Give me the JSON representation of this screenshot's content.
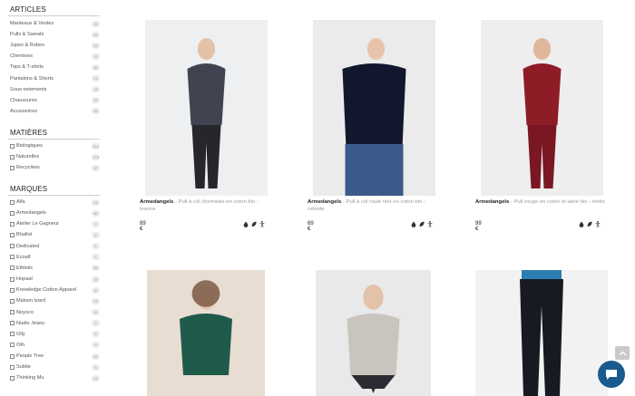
{
  "sidebar": {
    "articles": {
      "title": "ARTICLES",
      "items": [
        {
          "label": "Manteaux & Vestes",
          "count": "23"
        },
        {
          "label": "Pulls & Sweats",
          "count": "42"
        },
        {
          "label": "Jupes & Robes",
          "count": "24"
        },
        {
          "label": "Chemises",
          "count": "17"
        },
        {
          "label": "Tops & T-shirts",
          "count": "50"
        },
        {
          "label": "Pantalons & Shorts",
          "count": "21"
        },
        {
          "label": "Sous-vetements",
          "count": "15"
        },
        {
          "label": "Chaussures",
          "count": "34"
        },
        {
          "label": "Accessoires",
          "count": "45"
        }
      ]
    },
    "matieres": {
      "title": "MATIÈRES",
      "items": [
        {
          "label": "Biologiques",
          "count": "244"
        },
        {
          "label": "Naturelles",
          "count": "279"
        },
        {
          "label": "Recyclées",
          "count": "57"
        }
      ]
    },
    "marques": {
      "title": "MARQUES",
      "items": [
        {
          "label": "Alfa",
          "count": "22"
        },
        {
          "label": "Armedangels",
          "count": "90"
        },
        {
          "label": "Atelier Le Gagneur",
          "count": "7"
        },
        {
          "label": "Bhallot",
          "count": "4"
        },
        {
          "label": "Dedicated",
          "count": "1"
        },
        {
          "label": "Ecoalf",
          "count": "1"
        },
        {
          "label": "Ethletic",
          "count": "86"
        },
        {
          "label": "Hopaal",
          "count": "15"
        },
        {
          "label": "Knowledge Cotton Apparel",
          "count": "8"
        },
        {
          "label": "Maison Izard",
          "count": "13"
        },
        {
          "label": "Noyoco",
          "count": "41"
        },
        {
          "label": "Nudie Jeans",
          "count": "2"
        },
        {
          "label": "Olly",
          "count": "5"
        },
        {
          "label": "Oth",
          "count": "3"
        },
        {
          "label": "People Tree",
          "count": "22"
        },
        {
          "label": "Subtle",
          "count": "5"
        },
        {
          "label": "Thinking Mu",
          "count": "21"
        }
      ]
    }
  },
  "products": [
    {
      "brand": "Armedangels",
      "sep": " - ",
      "description": "Pull à col cheminée en coton bio - ivanna",
      "price": "89 €",
      "badges": [
        "drop-icon",
        "leaf-icon",
        "person-icon"
      ],
      "colors": {
        "bg": "#eeeff0",
        "top": "#3f4450",
        "bottom": "#26272c",
        "skin": "#e2c2a8"
      }
    },
    {
      "brand": "Armedangels",
      "sep": " - ",
      "description": "Pull à col roulé noir en coton bio - celeste",
      "price": "69 €",
      "badges": [
        "drop-icon",
        "leaf-icon",
        "person-icon"
      ],
      "colors": {
        "bg": "#ebebeb",
        "top": "#11182e",
        "bottom": "#3b5a8a",
        "skin": "#e8c4ad"
      }
    },
    {
      "brand": "Armedangels",
      "sep": " - ",
      "description": "Pull rouge en coton et laine bio - melin",
      "price": "99 €",
      "badges": [
        "drop-icon",
        "leaf-icon",
        "person-icon"
      ],
      "colors": {
        "bg": "#eeeeee",
        "top": "#8e1c26",
        "bottom": "#7a1722",
        "skin": "#dfb79c"
      }
    },
    {
      "colors": {
        "bg": "#e8ddd2",
        "top": "#1f5a4a",
        "bottom": "#1f5a4a",
        "skin": "#e8c7ad"
      }
    },
    {
      "colors": {
        "bg": "#e9e9e9",
        "top": "#c9c4bd",
        "bottom": "#2b2c33",
        "skin": "#e3c2aa"
      }
    },
    {
      "colors": {
        "bg": "#f2f2f2",
        "top": "#2d7fb1",
        "bottom": "#181a22",
        "skin": "#e1bfa6"
      }
    }
  ],
  "to_top_icon": "chevron-up-icon",
  "chat_icon": "chat-bubble-icon"
}
